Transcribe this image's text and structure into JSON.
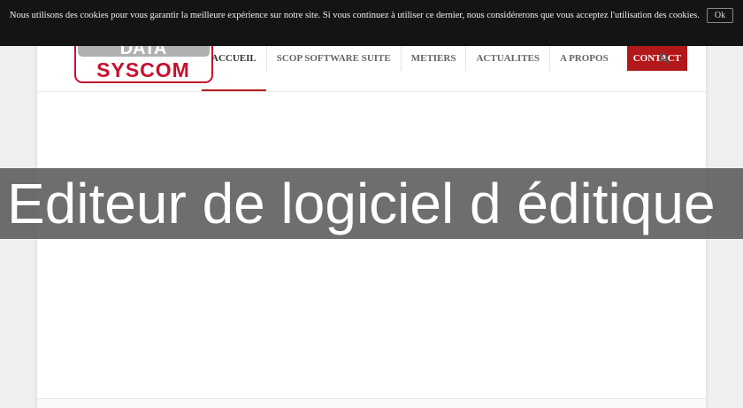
{
  "cookie_banner": {
    "text": "Nous utilisons des cookies pour vous garantir la meilleure expérience sur notre site. Si vous continuez à utiliser ce dernier, nous considérerons que vous acceptez l'utilisation des cookies.",
    "ok_label": "Ok"
  },
  "logo": {
    "top_text": "DATA",
    "bottom_text": "SYSCOM",
    "brand_color": "#c8102e"
  },
  "nav": {
    "items": [
      {
        "label": "ACCUEIL",
        "active": true
      },
      {
        "label": "SCOP SOFTWARE SUITE"
      },
      {
        "label": "METIERS"
      },
      {
        "label": "ACTUALITES"
      },
      {
        "label": "A PROPOS"
      },
      {
        "label": "CONTACT",
        "highlight": true
      }
    ],
    "search_icon": "search-icon",
    "accent_color": "#b2181a"
  },
  "overlay": {
    "title": "Editeur de logiciel d éditique"
  }
}
